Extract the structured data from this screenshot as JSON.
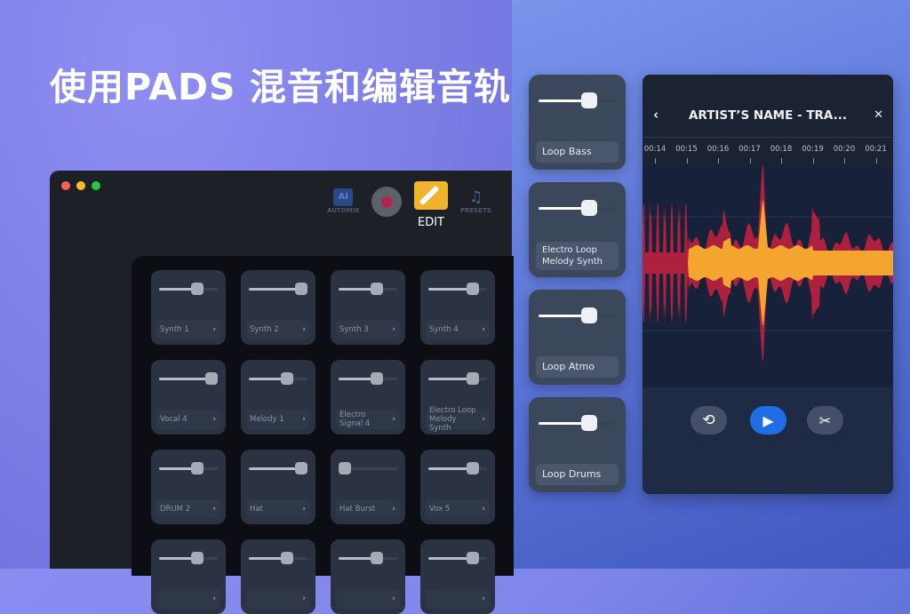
{
  "headline": "使用PADS 混音和编辑音轨",
  "toolbar": {
    "automix": "AUTOMIX",
    "record": "record",
    "edit": "EDIT",
    "presets": "PRESETS"
  },
  "pads": [
    {
      "label": "Synth 1",
      "level": 0.65
    },
    {
      "label": "Synth 2",
      "level": 0.9
    },
    {
      "label": "Synth 3",
      "level": 0.65
    },
    {
      "label": "Synth 4",
      "level": 0.75
    },
    {
      "label": "Vocal 4",
      "level": 0.9
    },
    {
      "label": "Melody 1",
      "level": 0.65
    },
    {
      "label": "Electro Signal 4",
      "level": 0.65
    },
    {
      "label": "Electro Loop Melody Synth",
      "level": 0.75
    },
    {
      "label": "DRUM 2",
      "level": 0.65
    },
    {
      "label": "Hat",
      "level": 0.9
    },
    {
      "label": "Hat Burst",
      "level": 0.1
    },
    {
      "label": "Vox 5",
      "level": 0.75
    },
    {
      "label": "",
      "level": 0.65
    },
    {
      "label": "",
      "level": 0.65
    },
    {
      "label": "",
      "level": 0.65
    },
    {
      "label": "",
      "level": 0.75
    }
  ],
  "big_pads": [
    {
      "label": "Loop Bass",
      "level": 0.65
    },
    {
      "label": "Electro Loop Melody Synth",
      "level": 0.65
    },
    {
      "label": "Loop Atmo",
      "level": 0.65
    },
    {
      "label": "Loop Drums",
      "level": 0.65
    }
  ],
  "editor": {
    "title": "ARTIST’S NAME - TRA...",
    "back": "‹",
    "close": "✕",
    "times": [
      "00:14",
      "00:15",
      "00:16",
      "00:17",
      "00:18",
      "00:19",
      "00:20",
      "00:21"
    ],
    "controls": {
      "undo": "undo-icon",
      "play": "play-icon",
      "cut": "scissors-icon"
    }
  },
  "colors": {
    "accent": "#1f6ee6",
    "edit": "#f0b32c",
    "wave_inner": "#f4a530",
    "wave_outer": "#c8203f"
  }
}
